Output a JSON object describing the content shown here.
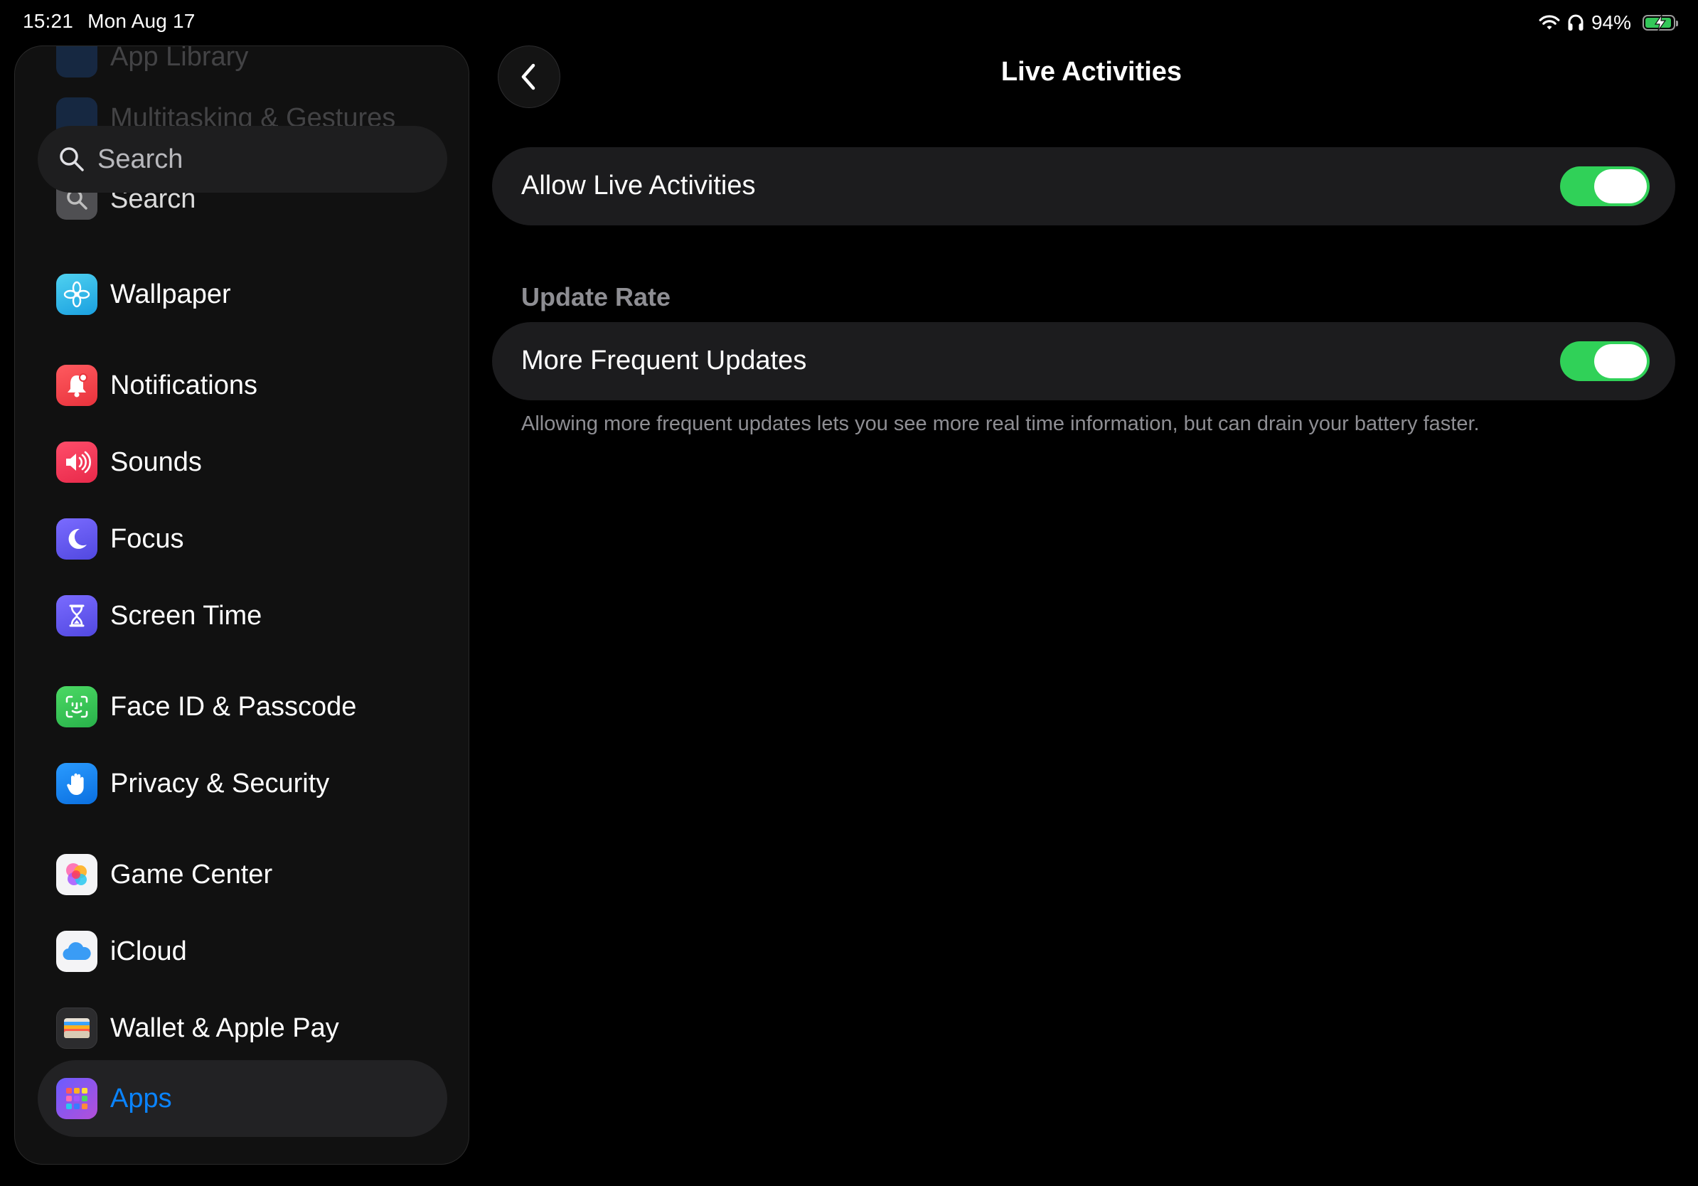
{
  "status_bar": {
    "time": "15:21",
    "date": "Mon Aug 17",
    "battery_percent": "94%",
    "battery_level": 0.94,
    "battery_color": "#34c759"
  },
  "sidebar": {
    "ghost_items": [
      "App Library",
      "Multitasking & Gestures"
    ],
    "search": {
      "placeholder": "Search"
    },
    "items": [
      {
        "label": "Search",
        "icon": "magnifier-icon",
        "color": "#5a5a5e"
      },
      {
        "label": "Wallpaper",
        "icon": "flower-icon",
        "color": "#2db5e6"
      },
      {
        "label": "Notifications",
        "icon": "bell-icon",
        "color": "#f0404a"
      },
      {
        "label": "Sounds",
        "icon": "speaker-icon",
        "color": "#f03a56"
      },
      {
        "label": "Focus",
        "icon": "moon-icon",
        "color": "#5e5ce6"
      },
      {
        "label": "Screen Time",
        "icon": "hourglass-icon",
        "color": "#5e5ce6"
      },
      {
        "label": "Face ID & Passcode",
        "icon": "faceid-icon",
        "color": "#34c759"
      },
      {
        "label": "Privacy & Security",
        "icon": "hand-icon",
        "color": "#0a84ff"
      },
      {
        "label": "Game Center",
        "icon": "bubbles-icon",
        "color": "#ffffff"
      },
      {
        "label": "iCloud",
        "icon": "cloud-icon",
        "color": "#ffffff"
      },
      {
        "label": "Wallet & Apple Pay",
        "icon": "wallet-icon",
        "color": "#2c2c2e"
      },
      {
        "label": "Apps",
        "icon": "apps-grid-icon",
        "color": "#7a5cf0",
        "selected": true
      }
    ]
  },
  "detail": {
    "title": "Live Activities",
    "back_icon": "chevron-left-icon",
    "allow_row": {
      "label": "Allow Live Activities",
      "on": true
    },
    "section_header": "Update Rate",
    "frequent_row": {
      "label": "More Frequent Updates",
      "on": true
    },
    "footnote": "Allowing more frequent updates lets you see more real time information, but can drain your battery faster.",
    "accent": "#30d158"
  }
}
